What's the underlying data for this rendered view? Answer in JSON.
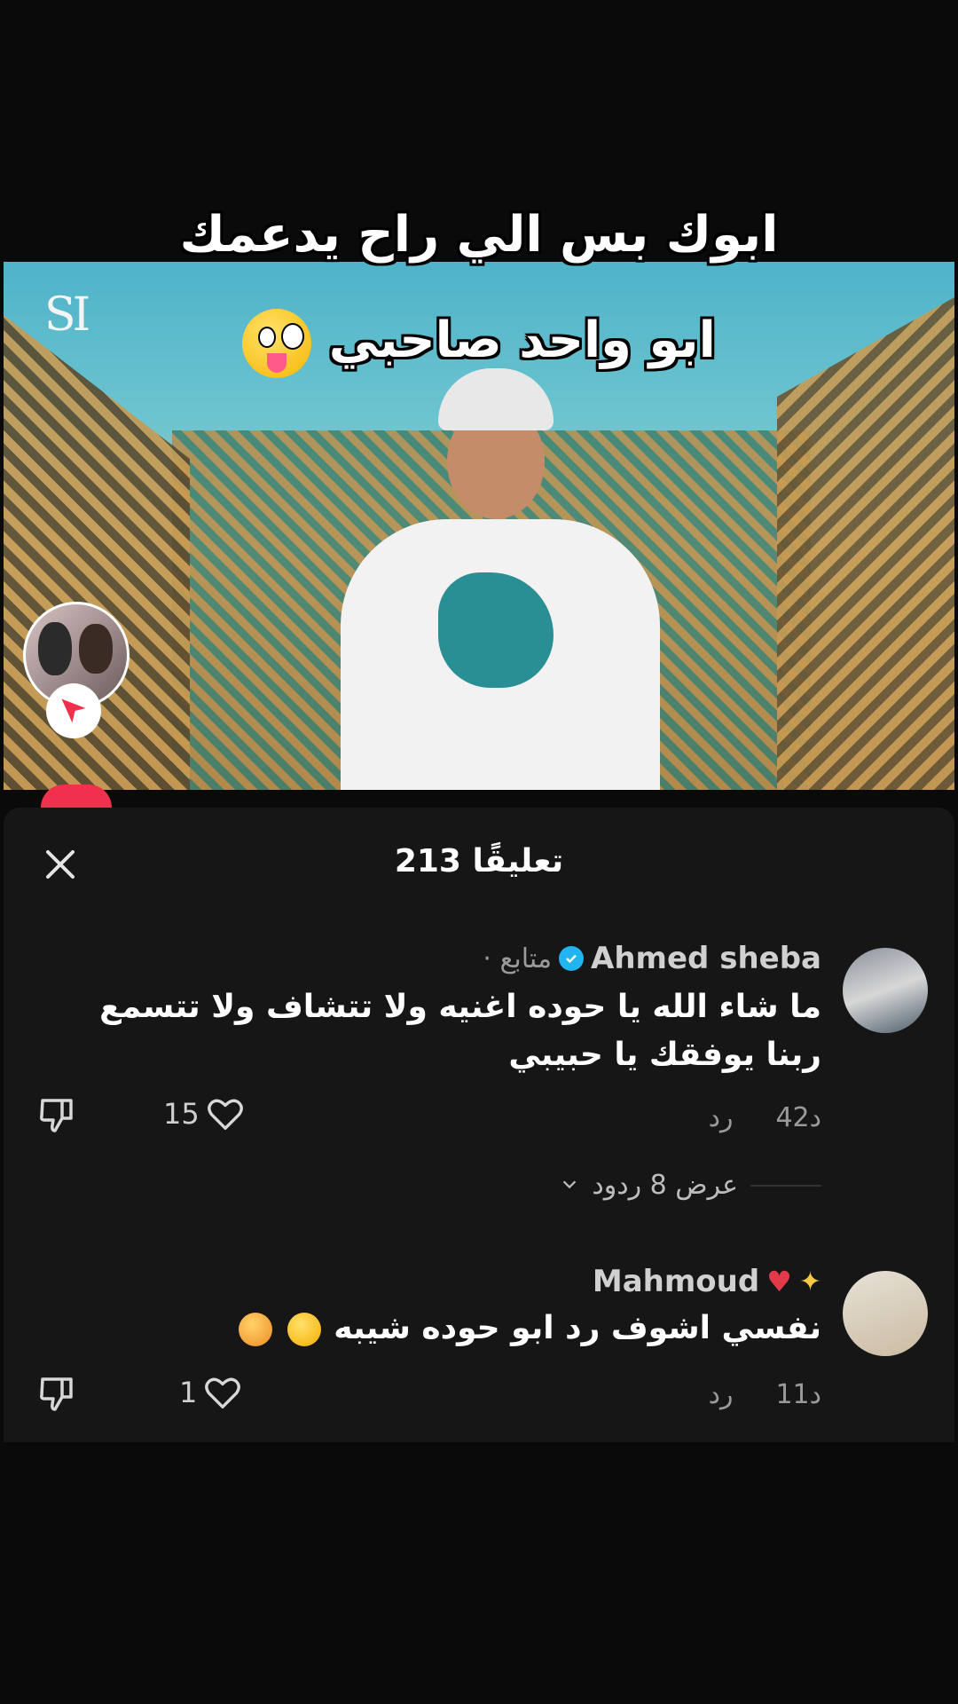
{
  "video": {
    "caption_line1": "ابوك بس الي راح يدعمك",
    "caption_line2": "ابو واحد صاحبي",
    "caption_emoji": "zany-face-emoji",
    "logo_text": "SI"
  },
  "sheet": {
    "count": "213",
    "count_label": "تعليقًا",
    "title": "213 تعليقًا"
  },
  "comments": [
    {
      "name": "Ahmed sheba",
      "verified": true,
      "tag": "· متابع",
      "text": "ما شاء الله يا حوده اغنيه ولا تتشاف ولا تتسمع ربنا يوفقك يا حبيبي",
      "time": "42د",
      "reply": "رد",
      "likes": "15",
      "view_replies": "عرض 8 ردود"
    },
    {
      "name": "Mahmoud",
      "name_emojis": "heart-sparkle",
      "text": "نفسي اشوف رد ابو حوده شيبه",
      "text_emojis": [
        "sweat-smile-emoji",
        "smiling-hearts-emoji"
      ],
      "time": "11د",
      "reply": "رد",
      "likes": "1"
    }
  ],
  "colors": {
    "background": "#0a0a0a",
    "sheet": "#161616",
    "heart_red": "#f0304d",
    "verified": "#20b4f0"
  }
}
